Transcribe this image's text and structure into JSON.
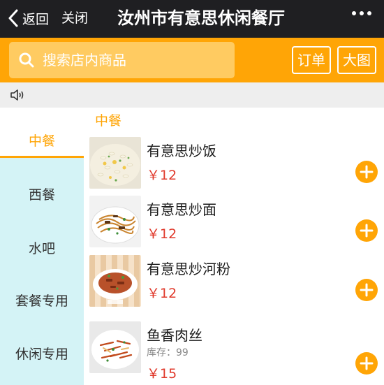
{
  "header": {
    "back_label": "返回",
    "close_label": "关闭",
    "title": "汝州市有意思休闲餐厅"
  },
  "search": {
    "placeholder": "搜索店内商品",
    "order_label": "订单",
    "bigpic_label": "大图"
  },
  "sidebar": {
    "items": [
      {
        "label": "中餐",
        "active": true
      },
      {
        "label": "西餐",
        "active": false
      },
      {
        "label": "水吧",
        "active": false
      },
      {
        "label": "套餐专用",
        "active": false
      },
      {
        "label": "休闲专用",
        "active": false
      }
    ]
  },
  "main": {
    "section_title": "中餐",
    "items": [
      {
        "name": "有意思炒饭",
        "price": "￥12",
        "stock": ""
      },
      {
        "name": "有意思炒面",
        "price": "￥12",
        "stock": ""
      },
      {
        "name": "有意思炒河粉",
        "price": "￥12",
        "stock": ""
      },
      {
        "name": "鱼香肉丝",
        "price": "￥15",
        "stock": "库存：99"
      }
    ]
  },
  "colors": {
    "accent": "#ffa506",
    "price": "#e0392b",
    "titlebar": "#1f1f22",
    "sidebar": "#d4f3f6"
  },
  "icons": [
    "back-chevron-icon",
    "more-dots-icon",
    "search-icon",
    "speaker-icon",
    "plus-icon"
  ]
}
